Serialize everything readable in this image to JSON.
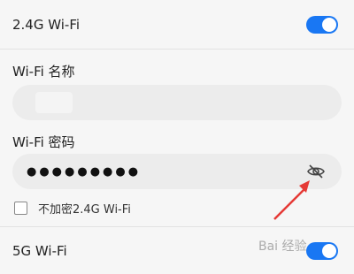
{
  "wifi24": {
    "label": "2.4G Wi-Fi",
    "enabled": true
  },
  "ssid": {
    "label": "Wi-Fi 名称",
    "value": ""
  },
  "password": {
    "label": "Wi-Fi 密码",
    "value": "●●●●●●●●●"
  },
  "no_password_24": {
    "label": "不加密2.4G Wi-Fi",
    "checked": false
  },
  "wifi5": {
    "label": "5G Wi-Fi",
    "enabled": true
  },
  "watermark": {
    "text": "Bai 经验"
  },
  "colors": {
    "accent": "#1977f3",
    "arrow": "#e53935"
  },
  "icons": {
    "password_toggle": "eye-off-icon"
  }
}
